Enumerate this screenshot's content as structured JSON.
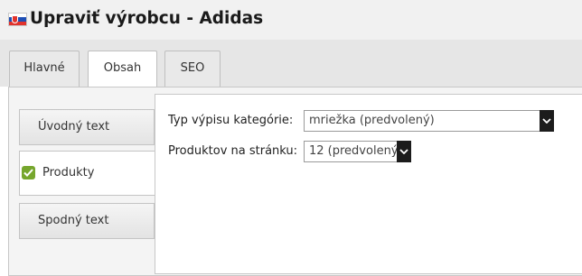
{
  "header": {
    "flag": "slovakia-flag",
    "title": "Upraviť výrobcu - Adidas"
  },
  "tabs": [
    {
      "label": "Hlavné",
      "active": false
    },
    {
      "label": "Obsah",
      "active": true
    },
    {
      "label": "SEO",
      "active": false
    }
  ],
  "side_tabs": [
    {
      "label": "Úvodný text",
      "active": false
    },
    {
      "label": "Produkty",
      "active": true,
      "icon": "check-icon"
    },
    {
      "label": "Spodný text",
      "active": false
    }
  ],
  "form": {
    "category_listing": {
      "label": "Typ výpisu kategórie:",
      "value": "mriežka (predvolený)"
    },
    "per_page": {
      "label": "Produktov na stránku:",
      "value": "12 (predvolený)"
    }
  },
  "colors": {
    "check": "#76a62d",
    "header_bg": "#f1f1f1",
    "select_arrow_bg": "#1c1c1c"
  }
}
